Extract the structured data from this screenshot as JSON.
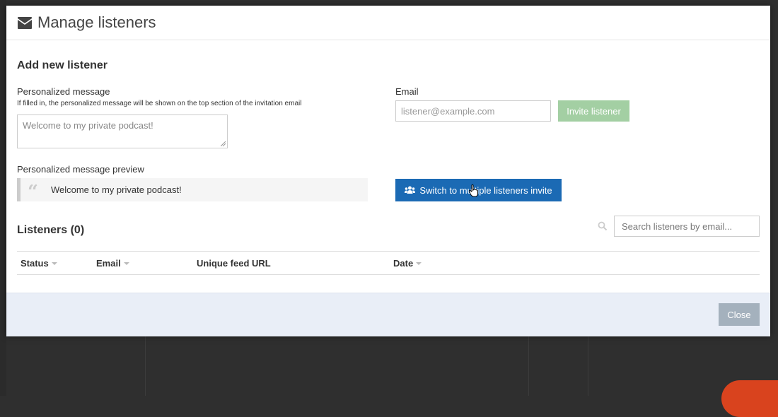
{
  "modal": {
    "title": "Manage listeners",
    "title_icon": "envelope-icon"
  },
  "add_listener": {
    "heading": "Add new listener",
    "message_label": "Personalized message",
    "message_help": "If filled in, the personalized message will be shown on the top section of the invitation email",
    "message_placeholder": "Welcome to my private podcast!",
    "preview_label": "Personalized message preview",
    "preview_text": "Welcome to my private podcast!",
    "email_label": "Email",
    "email_placeholder": "listener@example.com",
    "invite_label": "Invite listener",
    "switch_label": "Switch to multiple listeners invite",
    "switch_icon": "users-icon"
  },
  "listeners": {
    "heading": "Listeners (0)",
    "search_placeholder": "Search listeners by email...",
    "columns": [
      "Status",
      "Email",
      "Unique feed URL",
      "Date"
    ]
  },
  "footer": {
    "close_label": "Close"
  },
  "colors": {
    "primary": "#1b6ab4",
    "invite_disabled": "#a3cfa3",
    "close": "#a4b1bd",
    "footer_bg": "#e9eef7"
  }
}
